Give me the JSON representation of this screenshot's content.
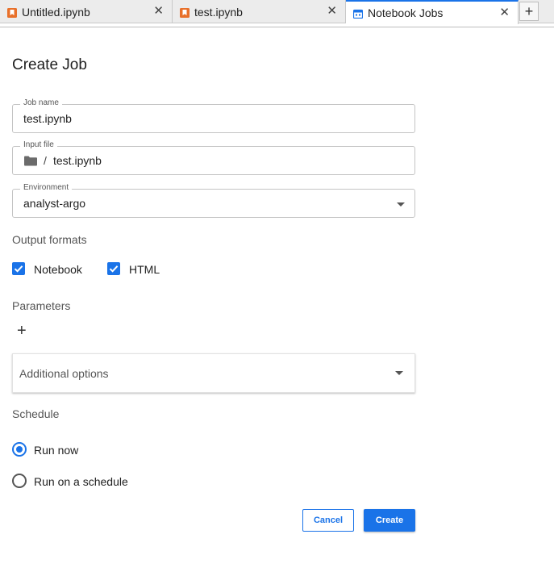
{
  "tabs": [
    {
      "label": "Untitled.ipynb",
      "icon": "notebook-icon",
      "close": "✕"
    },
    {
      "label": "test.ipynb",
      "icon": "notebook-icon",
      "close": "✕"
    },
    {
      "label": "Notebook Jobs",
      "icon": "calendar-icon",
      "close": "✕"
    }
  ],
  "new_tab": "+",
  "form": {
    "title": "Create Job",
    "job_name": {
      "label": "Job name",
      "value": "test.ipynb"
    },
    "input_file": {
      "label": "Input file",
      "separator": "/",
      "value": "test.ipynb"
    },
    "environment": {
      "label": "Environment",
      "value": "analyst-argo"
    },
    "output_formats": {
      "label": "Output formats",
      "options": [
        {
          "label": "Notebook",
          "checked": true
        },
        {
          "label": "HTML",
          "checked": true
        }
      ]
    },
    "parameters": {
      "label": "Parameters",
      "add": "+"
    },
    "additional_options": {
      "label": "Additional options"
    },
    "schedule": {
      "label": "Schedule",
      "options": [
        {
          "label": "Run now",
          "selected": true
        },
        {
          "label": "Run on a schedule",
          "selected": false
        }
      ]
    },
    "buttons": {
      "cancel": "Cancel",
      "create": "Create"
    }
  },
  "colors": {
    "accent": "#1a73e8",
    "notebook_icon": "#e8702a"
  }
}
